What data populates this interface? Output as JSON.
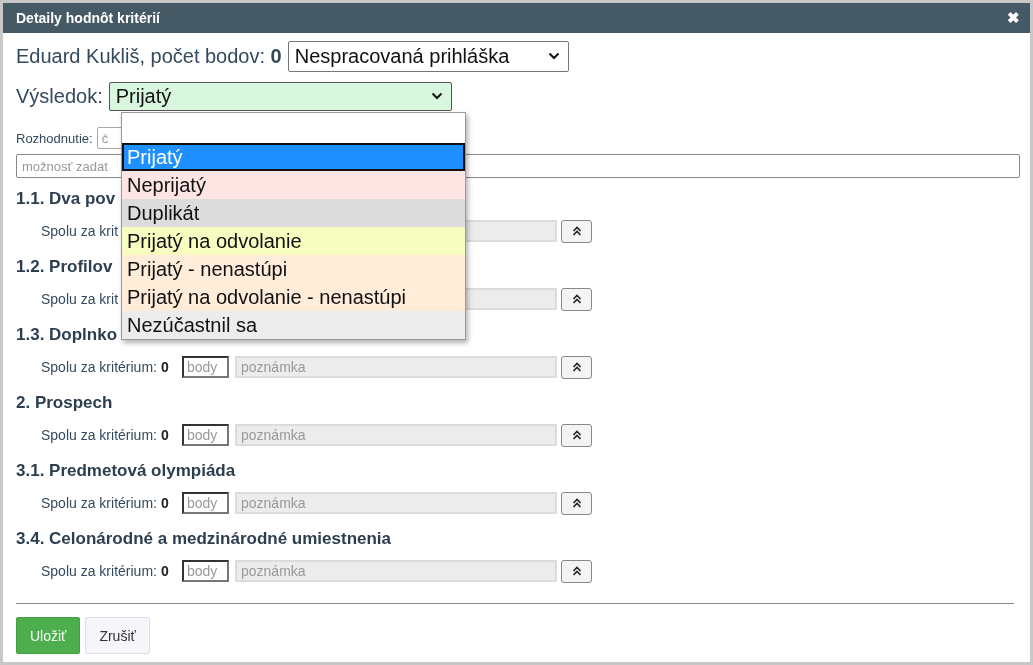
{
  "window": {
    "title": "Detaily hodnôt kritérií",
    "close": "✖"
  },
  "header": {
    "text": "Eduard Kukliš, počet bodov: **0**",
    "status_select": "Nespracovaná prihláška"
  },
  "result": {
    "label": "Výsledok:",
    "value": "Prijatý",
    "expanded": true,
    "options": [
      {
        "label": "Prijatý",
        "selected": true,
        "color": "#1e90ff"
      },
      {
        "label": "Neprijatý",
        "selected": false,
        "color": "#ffe4e4"
      },
      {
        "label": "Duplikát",
        "selected": false,
        "color": "#dcdcdc"
      },
      {
        "label": "Prijatý na odvolanie",
        "selected": false,
        "color": "#f7fdc0"
      },
      {
        "label": "Prijatý - nenastúpi",
        "selected": false,
        "color": "#ffecd9"
      },
      {
        "label": "Prijatý na odvolanie - nenastúpi",
        "selected": false,
        "color": "#ffecd9"
      },
      {
        "label": "Nezúčastnil sa",
        "selected": false,
        "color": "#ececec"
      }
    ]
  },
  "decision": {
    "label": "Rozhodnutie:",
    "placeholder": "č"
  },
  "comment": {
    "placeholder": "možnosť zadat"
  },
  "sections": [
    {
      "heading": "1.1. Dva pov",
      "label": "Spolu za krit"
    },
    {
      "heading": "1.2. Profilov",
      "label": "Spolu za krit"
    },
    {
      "heading": "1.3. Doplnko",
      "label": "Spolu za kritérium:",
      "points": "0",
      "body_placeholder": "body",
      "note_placeholder": "poznámka"
    },
    {
      "heading": "2. Prospech",
      "label": "Spolu za kritérium:",
      "points": "0",
      "body_placeholder": "body",
      "note_placeholder": "poznámka"
    },
    {
      "heading": "3.1. Predmetová olympiáda",
      "label": "Spolu za kritérium:",
      "points": "0",
      "body_placeholder": "body",
      "note_placeholder": "poznámka"
    },
    {
      "heading": "3.4. Celonárodné a medzinárodné umiestnenia",
      "label": "Spolu za kritérium:",
      "points": "0",
      "body_placeholder": "body",
      "note_placeholder": "poznámka"
    }
  ],
  "buttons": [
    {
      "label": "Uložiť",
      "kind": "primary"
    },
    {
      "label": "Zrušiť",
      "kind": "secondary"
    }
  ]
}
